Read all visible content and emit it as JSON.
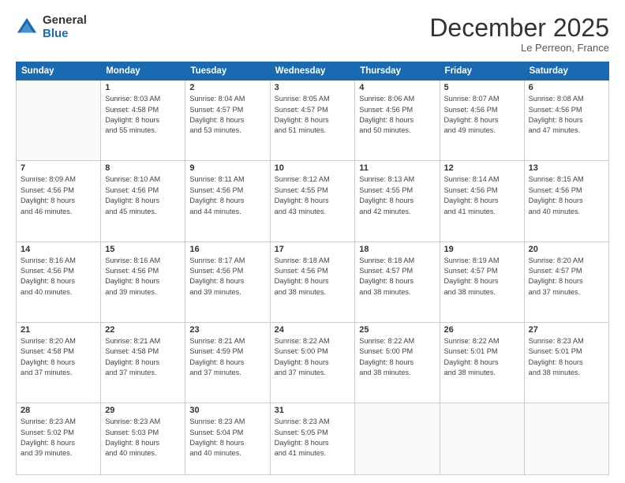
{
  "logo": {
    "general": "General",
    "blue": "Blue"
  },
  "title": "December 2025",
  "subtitle": "Le Perreon, France",
  "days_of_week": [
    "Sunday",
    "Monday",
    "Tuesday",
    "Wednesday",
    "Thursday",
    "Friday",
    "Saturday"
  ],
  "weeks": [
    [
      {
        "day": "",
        "info": ""
      },
      {
        "day": "1",
        "info": "Sunrise: 8:03 AM\nSunset: 4:58 PM\nDaylight: 8 hours\nand 55 minutes."
      },
      {
        "day": "2",
        "info": "Sunrise: 8:04 AM\nSunset: 4:57 PM\nDaylight: 8 hours\nand 53 minutes."
      },
      {
        "day": "3",
        "info": "Sunrise: 8:05 AM\nSunset: 4:57 PM\nDaylight: 8 hours\nand 51 minutes."
      },
      {
        "day": "4",
        "info": "Sunrise: 8:06 AM\nSunset: 4:56 PM\nDaylight: 8 hours\nand 50 minutes."
      },
      {
        "day": "5",
        "info": "Sunrise: 8:07 AM\nSunset: 4:56 PM\nDaylight: 8 hours\nand 49 minutes."
      },
      {
        "day": "6",
        "info": "Sunrise: 8:08 AM\nSunset: 4:56 PM\nDaylight: 8 hours\nand 47 minutes."
      }
    ],
    [
      {
        "day": "7",
        "info": "Sunrise: 8:09 AM\nSunset: 4:56 PM\nDaylight: 8 hours\nand 46 minutes."
      },
      {
        "day": "8",
        "info": "Sunrise: 8:10 AM\nSunset: 4:56 PM\nDaylight: 8 hours\nand 45 minutes."
      },
      {
        "day": "9",
        "info": "Sunrise: 8:11 AM\nSunset: 4:56 PM\nDaylight: 8 hours\nand 44 minutes."
      },
      {
        "day": "10",
        "info": "Sunrise: 8:12 AM\nSunset: 4:55 PM\nDaylight: 8 hours\nand 43 minutes."
      },
      {
        "day": "11",
        "info": "Sunrise: 8:13 AM\nSunset: 4:55 PM\nDaylight: 8 hours\nand 42 minutes."
      },
      {
        "day": "12",
        "info": "Sunrise: 8:14 AM\nSunset: 4:56 PM\nDaylight: 8 hours\nand 41 minutes."
      },
      {
        "day": "13",
        "info": "Sunrise: 8:15 AM\nSunset: 4:56 PM\nDaylight: 8 hours\nand 40 minutes."
      }
    ],
    [
      {
        "day": "14",
        "info": "Sunrise: 8:16 AM\nSunset: 4:56 PM\nDaylight: 8 hours\nand 40 minutes."
      },
      {
        "day": "15",
        "info": "Sunrise: 8:16 AM\nSunset: 4:56 PM\nDaylight: 8 hours\nand 39 minutes."
      },
      {
        "day": "16",
        "info": "Sunrise: 8:17 AM\nSunset: 4:56 PM\nDaylight: 8 hours\nand 39 minutes."
      },
      {
        "day": "17",
        "info": "Sunrise: 8:18 AM\nSunset: 4:56 PM\nDaylight: 8 hours\nand 38 minutes."
      },
      {
        "day": "18",
        "info": "Sunrise: 8:18 AM\nSunset: 4:57 PM\nDaylight: 8 hours\nand 38 minutes."
      },
      {
        "day": "19",
        "info": "Sunrise: 8:19 AM\nSunset: 4:57 PM\nDaylight: 8 hours\nand 38 minutes."
      },
      {
        "day": "20",
        "info": "Sunrise: 8:20 AM\nSunset: 4:57 PM\nDaylight: 8 hours\nand 37 minutes."
      }
    ],
    [
      {
        "day": "21",
        "info": "Sunrise: 8:20 AM\nSunset: 4:58 PM\nDaylight: 8 hours\nand 37 minutes."
      },
      {
        "day": "22",
        "info": "Sunrise: 8:21 AM\nSunset: 4:58 PM\nDaylight: 8 hours\nand 37 minutes."
      },
      {
        "day": "23",
        "info": "Sunrise: 8:21 AM\nSunset: 4:59 PM\nDaylight: 8 hours\nand 37 minutes."
      },
      {
        "day": "24",
        "info": "Sunrise: 8:22 AM\nSunset: 5:00 PM\nDaylight: 8 hours\nand 37 minutes."
      },
      {
        "day": "25",
        "info": "Sunrise: 8:22 AM\nSunset: 5:00 PM\nDaylight: 8 hours\nand 38 minutes."
      },
      {
        "day": "26",
        "info": "Sunrise: 8:22 AM\nSunset: 5:01 PM\nDaylight: 8 hours\nand 38 minutes."
      },
      {
        "day": "27",
        "info": "Sunrise: 8:23 AM\nSunset: 5:01 PM\nDaylight: 8 hours\nand 38 minutes."
      }
    ],
    [
      {
        "day": "28",
        "info": "Sunrise: 8:23 AM\nSunset: 5:02 PM\nDaylight: 8 hours\nand 39 minutes."
      },
      {
        "day": "29",
        "info": "Sunrise: 8:23 AM\nSunset: 5:03 PM\nDaylight: 8 hours\nand 40 minutes."
      },
      {
        "day": "30",
        "info": "Sunrise: 8:23 AM\nSunset: 5:04 PM\nDaylight: 8 hours\nand 40 minutes."
      },
      {
        "day": "31",
        "info": "Sunrise: 8:23 AM\nSunset: 5:05 PM\nDaylight: 8 hours\nand 41 minutes."
      },
      {
        "day": "",
        "info": ""
      },
      {
        "day": "",
        "info": ""
      },
      {
        "day": "",
        "info": ""
      }
    ]
  ]
}
